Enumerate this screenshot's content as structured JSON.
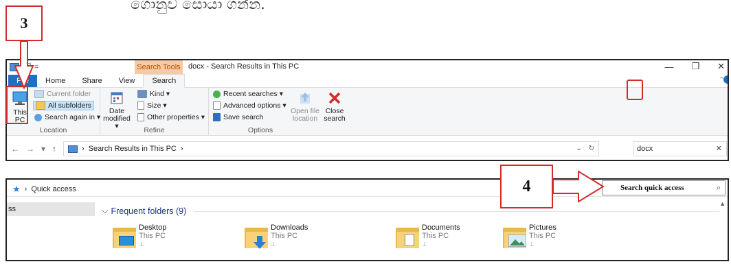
{
  "document": {
    "top_text": "ගොනුව සොයා ගන්න."
  },
  "callouts": {
    "three": "3",
    "four": "4"
  },
  "window1": {
    "quick_access_sep": "=",
    "contextual_tab": "Search Tools",
    "title": "docx - Search Results in This PC",
    "controls": {
      "minimize": "—",
      "maximize": "❐",
      "close": "✕"
    },
    "tabs": {
      "file": "File",
      "home": "Home",
      "share": "Share",
      "view": "View",
      "search": "Search"
    },
    "help": "⌃",
    "ribbon": {
      "location": {
        "label": "Location",
        "this_pc": [
          "This",
          "PC"
        ],
        "current_folder": "Current folder",
        "all_subfolders": "All subfolders",
        "search_again": "Search again in ▾"
      },
      "refine": {
        "label": "Refine",
        "date_modified": [
          "Date",
          "modified ▾"
        ],
        "kind": "Kind ▾",
        "size": "Size ▾",
        "other_properties": "Other properties ▾"
      },
      "options": {
        "label": "Options",
        "recent_searches": "Recent searches ▾",
        "advanced_options": "Advanced options ▾",
        "save_search": "Save search",
        "open_file_location": [
          "Open file",
          "location"
        ],
        "close_search": [
          "Close",
          "search"
        ]
      }
    },
    "address": {
      "back": "←",
      "forward": "→",
      "recent": "▾",
      "up": "↑",
      "sep1": "›",
      "path": "Search Results in This PC",
      "sep2": "›",
      "dropdown": "⌄",
      "refresh": "↻",
      "search_value": "docx",
      "clear": "✕"
    }
  },
  "window2": {
    "path_sep": "›",
    "path": "Quick access",
    "search_placeholder": "Search quick access",
    "search_icon": "⌕",
    "nav_selected": "ss",
    "frequent_header": "Frequent folders (9)",
    "frequent_chevron": "⌵",
    "scroll_up": "▲",
    "folders": [
      {
        "name": "Desktop",
        "location": "This PC",
        "pin": "📌"
      },
      {
        "name": "Downloads",
        "location": "This PC",
        "pin": "📌"
      },
      {
        "name": "Documents",
        "location": "This PC",
        "pin": "📌"
      },
      {
        "name": "Pictures",
        "location": "This PC",
        "pin": "📌"
      }
    ]
  }
}
